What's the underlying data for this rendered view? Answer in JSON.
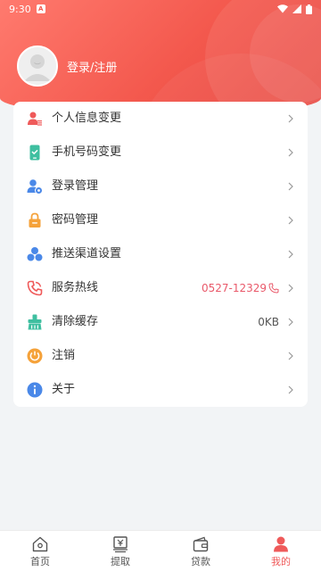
{
  "status_bar": {
    "time": "9:30",
    "app_badge": "A"
  },
  "profile": {
    "login_label": "登录/注册"
  },
  "menu": {
    "items": [
      {
        "label": "个人信息变更",
        "value": "",
        "icon": "user-edit-icon",
        "color": "#ef5a5a"
      },
      {
        "label": "手机号码变更",
        "value": "",
        "icon": "phone-check-icon",
        "color": "#3fbfa0"
      },
      {
        "label": "登录管理",
        "value": "",
        "icon": "user-settings-icon",
        "color": "#4a88e8"
      },
      {
        "label": "密码管理",
        "value": "",
        "icon": "lock-icon",
        "color": "#f5a23a"
      },
      {
        "label": "推送渠道设置",
        "value": "",
        "icon": "channels-icon",
        "color": "#4a88e8"
      },
      {
        "label": "服务热线",
        "value": "0527-12329",
        "icon": "phone-icon",
        "color": "#ef5a5a"
      },
      {
        "label": "清除缓存",
        "value": "0KB",
        "icon": "cache-icon",
        "color": "#3fbfa0"
      },
      {
        "label": "注销",
        "value": "",
        "icon": "power-icon",
        "color": "#f5a23a"
      },
      {
        "label": "关于",
        "value": "",
        "icon": "info-icon",
        "color": "#4a88e8"
      }
    ]
  },
  "bottom_nav": {
    "items": [
      {
        "label": "首页",
        "icon": "home-icon",
        "active": false
      },
      {
        "label": "提取",
        "icon": "withdraw-icon",
        "active": false
      },
      {
        "label": "贷款",
        "icon": "wallet-icon",
        "active": false
      },
      {
        "label": "我的",
        "icon": "profile-icon",
        "active": true
      }
    ]
  },
  "colors": {
    "header": "#f3584d",
    "accent_red": "#ef5a5a",
    "hotline": "#e9596a",
    "background": "#f2f4f6"
  }
}
